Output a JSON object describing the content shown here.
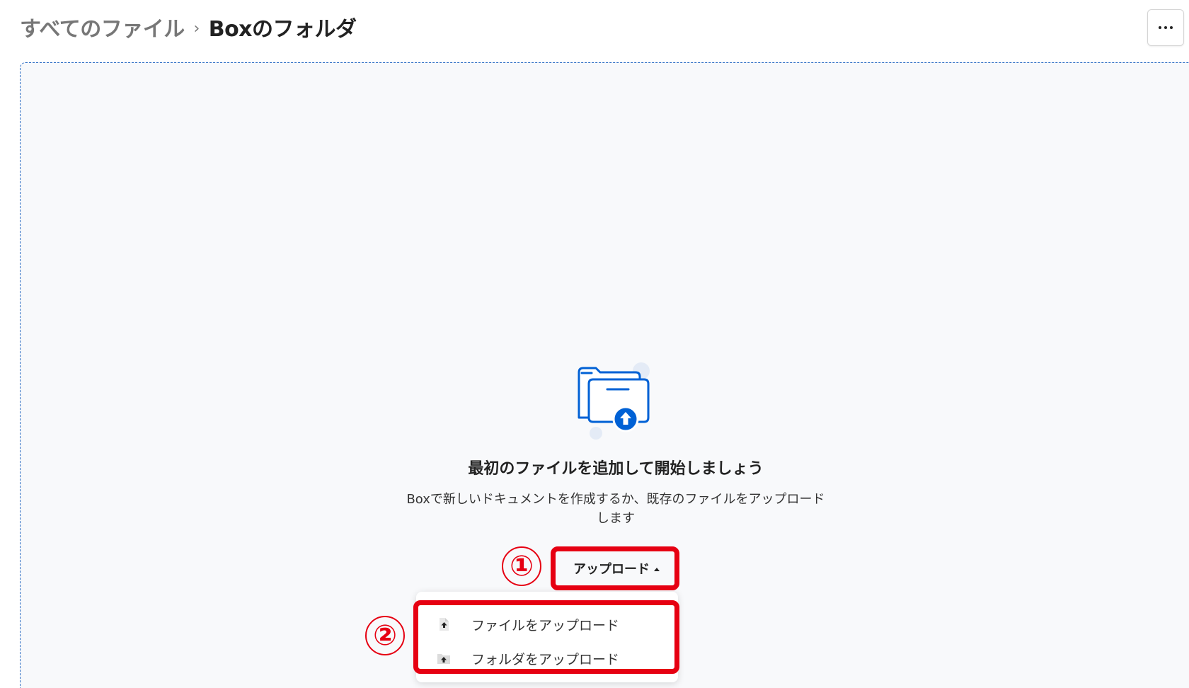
{
  "breadcrumb": {
    "parent": "すべてのファイル",
    "separator": "›",
    "current": "Boxのフォルダ"
  },
  "header": {
    "more_button_icon": "more-horizontal-icon"
  },
  "empty_state": {
    "illustration_icon": "folder-upload-icon",
    "title": "最初のファイルを追加して開始しましょう",
    "subtitle": "Boxで新しいドキュメントを作成するか、既存のファイルをアップロードします"
  },
  "upload": {
    "button_label": "アップロード",
    "menu_items": [
      {
        "label": "ファイルをアップロード",
        "icon": "file-upload-icon"
      },
      {
        "label": "フォルダをアップロード",
        "icon": "folder-upload-icon"
      }
    ]
  },
  "annotations": {
    "step1": "①",
    "step2": "②",
    "color": "#e60012"
  },
  "colors": {
    "accent": "#0061d5",
    "dropzone_border": "#2b6cc4",
    "dropzone_bg": "#f8f9fb"
  }
}
